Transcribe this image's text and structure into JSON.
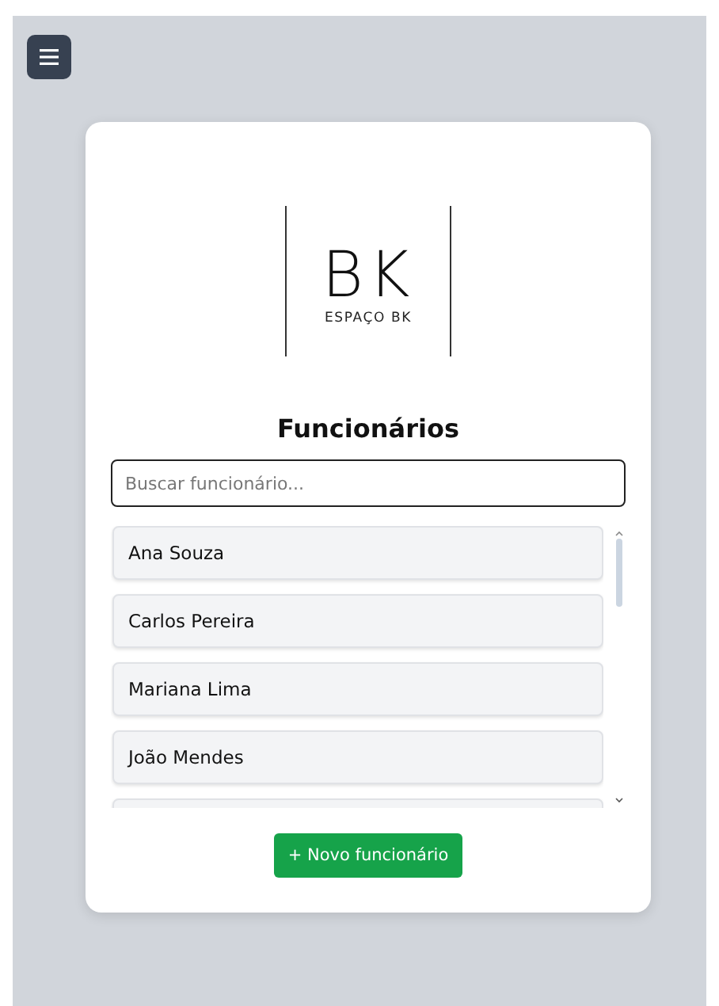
{
  "logo": {
    "mark": "BK",
    "name": "ESPAÇO BK"
  },
  "title": "Funcionários",
  "search": {
    "placeholder": "Buscar funcionário..."
  },
  "employees": [
    {
      "name": "Ana Souza"
    },
    {
      "name": "Carlos Pereira"
    },
    {
      "name": "Mariana Lima"
    },
    {
      "name": "João Mendes"
    }
  ],
  "add_button": "+ Novo funcionário"
}
